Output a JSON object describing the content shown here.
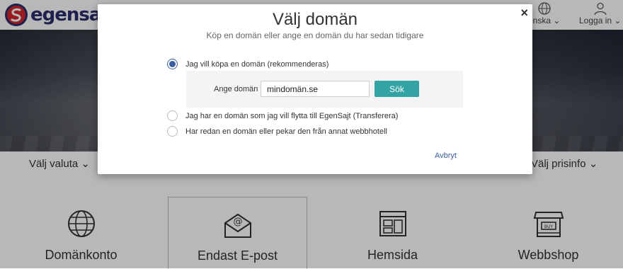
{
  "header": {
    "logo_text": "egensajt",
    "language_label": "enska",
    "login_label": "Logga in"
  },
  "filters": {
    "currency_label": "Välj valuta",
    "priceinfo_label": "Välj prisinfo"
  },
  "cards": [
    {
      "label": "Domänkonto",
      "icon": "globe-icon"
    },
    {
      "label": "Endast E-post",
      "icon": "email-icon"
    },
    {
      "label": "Hemsida",
      "icon": "website-icon"
    },
    {
      "label": "Webbshop",
      "icon": "shop-icon"
    }
  ],
  "modal": {
    "title": "Välj domän",
    "subtitle": "Köp en domän eller ange en domän du har sedan tidigare",
    "close_symbol": "×",
    "options": [
      {
        "label": "Jag vill köpa en domän (rekommenderas)",
        "checked": true
      },
      {
        "label": "Jag har en domän som jag vill flytta till EgenSajt (Transferera)",
        "checked": false
      },
      {
        "label": "Har redan en domän eller pekar den från annat webbhotell",
        "checked": false
      }
    ],
    "domain_field_label": "Ange domän",
    "domain_value": "mindomän.se",
    "search_label": "Sök",
    "cancel_label": "Avbryt"
  },
  "colors": {
    "accent": "#3b5ea3",
    "button": "#33a3a3",
    "logo_red": "#d0282e",
    "logo_navy": "#2a2f6b"
  }
}
